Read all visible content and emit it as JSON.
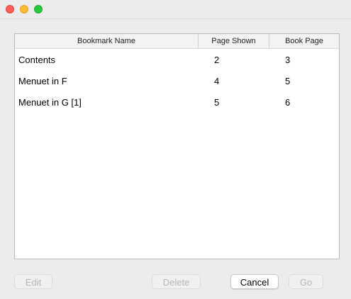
{
  "window": {
    "traffic_lights": {
      "close": "#fe5f57",
      "minimize": "#febc2e",
      "zoom": "#28c840"
    }
  },
  "table": {
    "columns": [
      "Bookmark Name",
      "Page Shown",
      "Book Page"
    ],
    "rows": [
      {
        "name": "Contents",
        "page_shown": "2",
        "book_page": "3"
      },
      {
        "name": "Menuet in F",
        "page_shown": "4",
        "book_page": "5"
      },
      {
        "name": "Menuet in G [1]",
        "page_shown": "5",
        "book_page": "6"
      }
    ]
  },
  "buttons": {
    "edit": {
      "label": "Edit",
      "enabled": false
    },
    "delete": {
      "label": "Delete",
      "enabled": false
    },
    "cancel": {
      "label": "Cancel",
      "enabled": true
    },
    "go": {
      "label": "Go",
      "enabled": false
    }
  }
}
